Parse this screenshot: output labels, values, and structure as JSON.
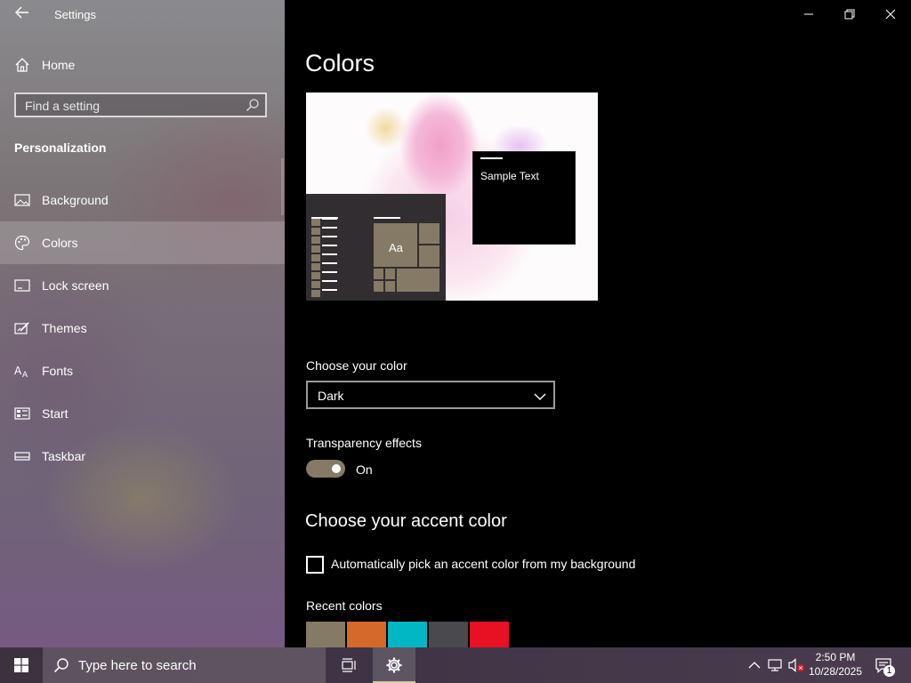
{
  "window": {
    "app_title": "Settings",
    "minimize_glyph": "—",
    "restore_glyph": "❐",
    "close_glyph": "✕"
  },
  "sidebar": {
    "home_label": "Home",
    "search_placeholder": "Find a setting",
    "section_heading": "Personalization",
    "items": [
      {
        "label": "Background",
        "icon": "image-icon"
      },
      {
        "label": "Colors",
        "icon": "palette-icon",
        "selected": true
      },
      {
        "label": "Lock screen",
        "icon": "lock-screen-icon"
      },
      {
        "label": "Themes",
        "icon": "themes-icon"
      },
      {
        "label": "Fonts",
        "icon": "fonts-icon"
      },
      {
        "label": "Start",
        "icon": "start-icon"
      },
      {
        "label": "Taskbar",
        "icon": "taskbar-icon"
      }
    ]
  },
  "main": {
    "page_title": "Colors",
    "preview": {
      "sample_text": "Sample Text",
      "tile_text": "Aa"
    },
    "choose_color_label": "Choose your color",
    "choose_color_value": "Dark",
    "transparency_label": "Transparency effects",
    "transparency_state": "On",
    "accent_heading": "Choose your accent color",
    "auto_pick_label": "Automatically pick an accent color from my background",
    "auto_pick_checked": false,
    "recent_colors_label": "Recent colors",
    "recent_colors": [
      "#857a65",
      "#d5692a",
      "#00b7c3",
      "#4a4a4e",
      "#e81123"
    ]
  },
  "taskbar": {
    "search_placeholder": "Type here to search",
    "time": "2:50 PM",
    "date": "10/28/2025",
    "notification_count": "1"
  },
  "colors": {
    "accent": "#857a65",
    "background": "#000000"
  }
}
